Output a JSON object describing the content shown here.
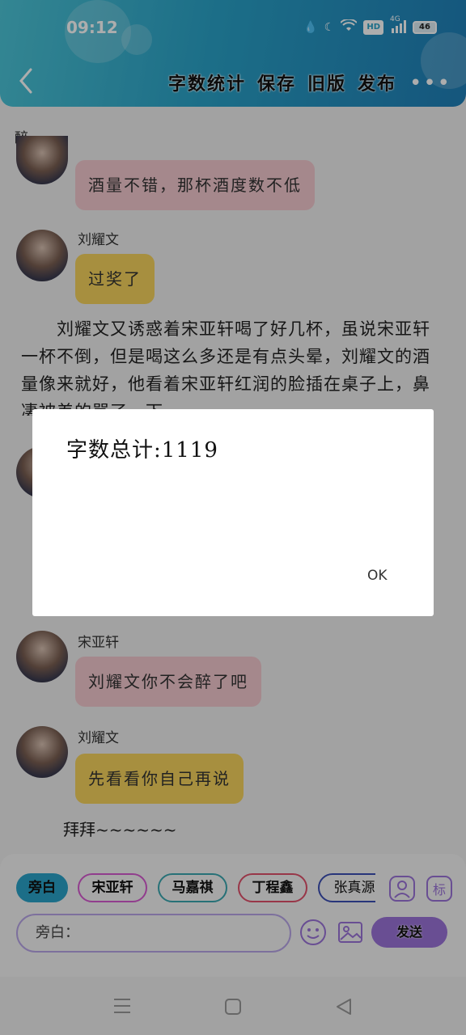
{
  "status_bar": {
    "time": "09:12",
    "network": "4G",
    "hd": "HD",
    "battery": "46"
  },
  "header": {
    "actions": [
      "字数统计",
      "保存",
      "旧版",
      "发布"
    ],
    "more": "•••"
  },
  "content": {
    "section_title": "醉",
    "messages": [
      {
        "speaker": "",
        "text": "酒量不错，那杯酒度数不低",
        "style": "pink"
      },
      {
        "speaker": "刘耀文",
        "text": "过奖了",
        "style": "yellow"
      },
      {
        "speaker": "宋亚轩",
        "text": "刘耀文你不会醉了吧",
        "style": "pink"
      },
      {
        "speaker": "刘耀文",
        "text": "先看看你自己再说",
        "style": "yellow"
      }
    ],
    "narration": "　　刘耀文又诱惑着宋亚轩喝了好几杯，虽说宋亚轩一杯不倒，但是喝这么多还是有点头晕，刘耀文的酒量像来就好，他看着宋亚轩红润的脸插在桌子上，鼻凄被差的骂了，下",
    "bye": "拜拜~~~~~~"
  },
  "bottom": {
    "chips": [
      {
        "label": "旁白",
        "border": "#2aa3c9",
        "bg": "#2aa3c9"
      },
      {
        "label": "宋亚轩",
        "border": "#d65ad0",
        "bg": "transparent"
      },
      {
        "label": "马嘉祺",
        "border": "#3aa7b0",
        "bg": "transparent"
      },
      {
        "label": "丁程鑫",
        "border": "#e0506a",
        "bg": "transparent"
      },
      {
        "label": "张真源",
        "border": "#3c4fb4",
        "bg": "transparent"
      }
    ],
    "input_placeholder": "旁白：",
    "send_label": "发送"
  },
  "dialog": {
    "text": "字数总计:1119",
    "ok_label": "OK"
  },
  "colors": {
    "header_start": "#4dc6d8",
    "header_end": "#1f7fb8",
    "overlay": "rgba(0,0,0,0.32)",
    "accent_purple": "#9b73d9"
  }
}
